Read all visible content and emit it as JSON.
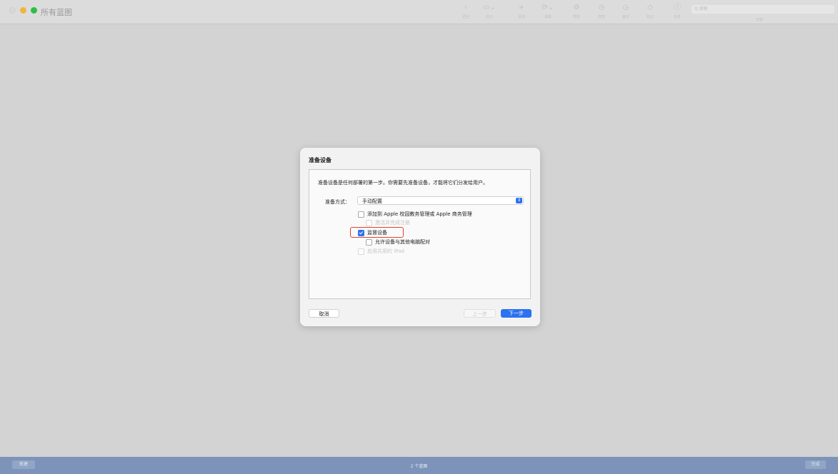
{
  "window": {
    "title": "所有蓝图"
  },
  "toolbar": {
    "items": [
      {
        "icon": "back-chevron-icon",
        "glyph": "‹",
        "label": "返回"
      },
      {
        "icon": "display-icon",
        "glyph": "▭⌄",
        "label": "显示"
      },
      {
        "icon": "plus-icon",
        "glyph": "+",
        "label": "添加"
      },
      {
        "icon": "prepare-icon",
        "glyph": "⟳⌄",
        "label": "准备"
      },
      {
        "icon": "gear-icon",
        "glyph": "⚙",
        "label": "修改"
      },
      {
        "icon": "restore-icon",
        "glyph": "◷",
        "label": "恢复"
      },
      {
        "icon": "backup-icon",
        "glyph": "◶",
        "label": "备份"
      },
      {
        "icon": "tag-icon",
        "glyph": "◇",
        "label": "标记"
      },
      {
        "icon": "info-icon",
        "glyph": "ⓘ",
        "label": "信息"
      }
    ],
    "search_placeholder": "Q 搜索",
    "search_label": "搜索"
  },
  "dialog": {
    "title": "准备设备",
    "description": "准备设备是任何部署的第一步。你需要先准备设备，才能将它们分发给用户。",
    "method_label": "准备方式：",
    "method_value": "手动配置",
    "options": {
      "add_to_abm": "添加到 Apple 校园教务管理或 Apple 商务管理",
      "activate_register": "激活并完成注册",
      "supervise": "监督设备",
      "allow_pair": "允许设备与其他电脑配对",
      "shared_ipad": "启用共用的 iPad"
    },
    "cancel": "取消",
    "previous": "上一步",
    "next": "下一步"
  },
  "bottom": {
    "new": "新建",
    "count": "2 个蓝图",
    "done": "完成"
  },
  "colors": {
    "accent": "#2b72f0",
    "highlight": "#e2412f",
    "bottom_bar": "#7d93b9"
  }
}
